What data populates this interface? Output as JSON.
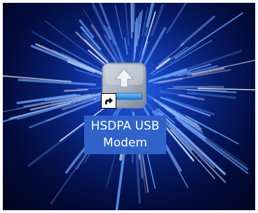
{
  "desktop": {
    "background": {
      "name": "blue-warp-starburst-wallpaper",
      "colors": {
        "core": "#1a55d8",
        "mid": "#0d2f9e",
        "edge": "#01051c",
        "ray": "#6fa8ff"
      }
    },
    "shortcut": {
      "label_line1": "HSDPA USB",
      "label_line2": "Modem",
      "icon": "usb-modem-install-icon",
      "overlay_icon": "shortcut-arrow-icon",
      "selected": true,
      "selection_color": "#2f63c9"
    }
  }
}
